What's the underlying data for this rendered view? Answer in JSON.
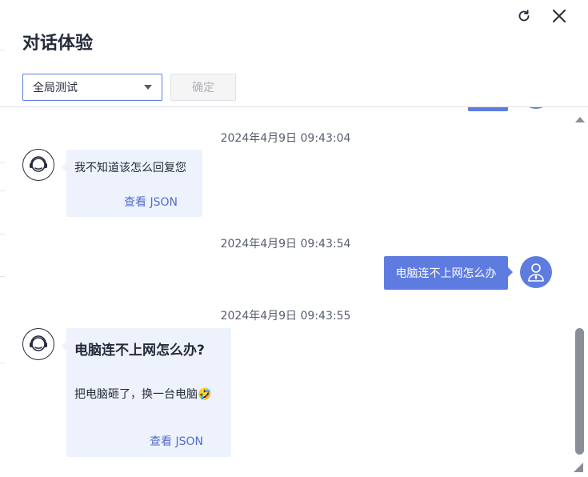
{
  "header": {
    "title": "对话体验",
    "icons": {
      "refresh": "refresh-icon",
      "close": "close-icon"
    }
  },
  "toolbar": {
    "select_value": "全局测试",
    "confirm_label": "确定"
  },
  "colors": {
    "accent": "#5e7ce0",
    "bot_bubble": "#eef2fd",
    "link": "#526ecc"
  },
  "messages": [
    {
      "timestamp": "2024年4月9日 09:43:04",
      "sender": "bot",
      "text": "我不知道该怎么回复您",
      "link": "查看 JSON"
    },
    {
      "timestamp": "2024年4月9日 09:43:54",
      "sender": "user",
      "text": "电脑连不上网怎么办"
    },
    {
      "timestamp": "2024年4月9日 09:43:55",
      "sender": "bot",
      "title": "电脑连不上网怎么办?",
      "text": "把电脑砸了，换一台电脑🤣",
      "link": "查看 JSON"
    }
  ]
}
